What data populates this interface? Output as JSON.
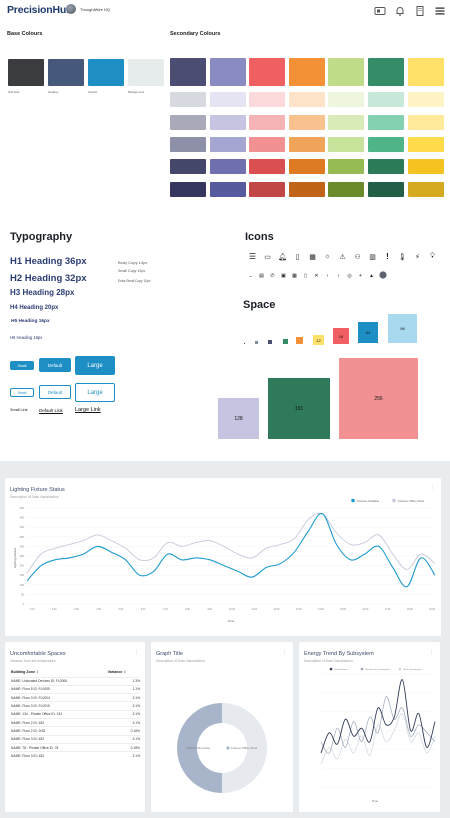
{
  "app": {
    "logo": "PrecisionHub",
    "org": "ThoughtWire HQ"
  },
  "colours": {
    "base_title": "Base Colours",
    "secondary_title": "Secondary Colours",
    "base": [
      {
        "name": "Sub Nav",
        "hex": "#3a3c40"
      },
      {
        "name": "Heather",
        "hex": "#46597a"
      },
      {
        "name": "Solaris",
        "hex": "#1e8fc5"
      },
      {
        "name": "Background",
        "hex": "#e6ebec"
      }
    ],
    "secondary_columns": [
      [
        "#4b4d72",
        "#d7d9e0",
        "#a9aab9",
        "#8e8fa8",
        "#45476a",
        "#35375e"
      ],
      [
        "#8b8bc4",
        "#e4e4f3",
        "#c5c5e2",
        "#a5a5d2",
        "#6f6fb0",
        "#565ba0"
      ],
      [
        "#f05f62",
        "#fcd9da",
        "#f6b3b5",
        "#f29194",
        "#d94f52",
        "#c14648"
      ],
      [
        "#f29136",
        "#fde3c8",
        "#f8c28e",
        "#f0a45a",
        "#dd7a22",
        "#c0641a"
      ],
      [
        "#bfdc88",
        "#eef6dd",
        "#d9ebb6",
        "#c7e29b",
        "#96bb52",
        "#6a8a2c"
      ],
      [
        "#358c68",
        "#c7e8d9",
        "#84d1b1",
        "#4fb487",
        "#2b7a58",
        "#225f46"
      ],
      [
        "#ffe16a",
        "#fff4c6",
        "#ffe99b",
        "#ffdb4a",
        "#f4c321",
        "#d6aa20"
      ]
    ]
  },
  "typography": {
    "title": "Typography",
    "h1": "H1 Heading 36px",
    "h2": "H2 Heading 32px",
    "h3": "H3 Heading 28px",
    "h4": "H4 Heading 20px",
    "h5": "H5 Heading 16px",
    "h6": "H6 Heading 16px",
    "body": "Body Copy 14px",
    "small": "Small Copy 12px",
    "extra_small": "Extra Small Copy 10px",
    "btn_small": "Small",
    "btn_default": "Default",
    "btn_large": "Large",
    "link_small": "Small Link",
    "link_default": "Default Link",
    "link_large": "Large Link"
  },
  "icons": {
    "title": "Icons"
  },
  "space": {
    "title": "Space",
    "labels": [
      "",
      "",
      "",
      "",
      "",
      "12",
      "16",
      "64",
      "96",
      "128",
      "191",
      "256"
    ]
  },
  "lighting": {
    "title": "Lighting Fixture Status",
    "subtitle": "Description of Data Visualization",
    "legend": [
      "Fixtures Available",
      "Fixtures Offline Shed"
    ],
    "ylabel": "Lighting Fixtures",
    "xlabel": "Time"
  },
  "spaces": {
    "title": "Uncomfortable Spaces",
    "subtitle": "Variance from set temperature",
    "col1": "Building Zone",
    "col2": "Variance",
    "rows": [
      [
        "NAME: Unlocated Devices ID: FL0006",
        "1.3%"
      ],
      [
        "NAME: Floor 5 ID: FL0005",
        "1.1%"
      ],
      [
        "NAME: Floor 3 ID: FL0004",
        "3.1%"
      ],
      [
        "NAME: Floor 3 ID: FL0015",
        "3.1%"
      ],
      [
        "NAME: 134 - Private Office ID: 134",
        "3.1%"
      ],
      [
        "NAME: Floor 2 ID: 452",
        "3.1%"
      ],
      [
        "NAME: Floor 2 ID: 2r52",
        "0.18%"
      ],
      [
        "NAME: Floor 3 ID: 452",
        "3.1%"
      ],
      [
        "NAME: 78 - Private Office ID: 78",
        "0.18%"
      ],
      [
        "NAME: Floor 3 ID: 452",
        "3.1%"
      ]
    ]
  },
  "graph": {
    "title": "Graph Title",
    "subtitle": "Description of Data Visualization",
    "legend": [
      "Fixtures Off at Area",
      "Fixtures Offline Shed"
    ]
  },
  "energy": {
    "title": "Energy Trend By Subsystem",
    "subtitle": "Description of Data Visualization",
    "legend": [
      "Default Name",
      "Mechanical Consumption",
      "Plant Consumption"
    ],
    "xlabel": "Time"
  },
  "chart_data": [
    {
      "type": "line",
      "series": [
        {
          "name": "Fixtures Available",
          "values": [
            120,
            200,
            230,
            240,
            260,
            300,
            270,
            230,
            150,
            170,
            260,
            230,
            240,
            230,
            200,
            170,
            140,
            190,
            210,
            270,
            380,
            470,
            310,
            230,
            260,
            300,
            190,
            90,
            240,
            150
          ]
        },
        {
          "name": "Fixtures Offline Shed",
          "values": [
            160,
            260,
            290,
            310,
            330,
            360,
            330,
            290,
            230,
            240,
            320,
            300,
            320,
            330,
            300,
            260,
            240,
            290,
            310,
            340,
            440,
            470,
            370,
            310,
            320,
            360,
            260,
            180,
            260,
            210
          ]
        }
      ],
      "ylim": [
        0,
        500
      ],
      "ylabel": "Lighting Fixtures",
      "xlabel": "Time"
    },
    {
      "type": "pie",
      "series": [
        {
          "name": "Fixtures Off at Area",
          "values": [
            50
          ]
        },
        {
          "name": "Fixtures Offline Shed",
          "values": [
            50
          ]
        }
      ]
    },
    {
      "type": "line",
      "series": [
        {
          "name": "Default Name",
          "values": [
            30,
            48,
            38,
            60,
            45,
            52,
            40,
            70,
            55,
            62,
            95,
            50,
            65,
            35,
            58
          ]
        },
        {
          "name": "Mechanical Consumption",
          "values": [
            40,
            30,
            52,
            35,
            58,
            40,
            62,
            48,
            80,
            60,
            70,
            45,
            55,
            48,
            40
          ]
        },
        {
          "name": "Plant Consumption",
          "values": [
            20,
            35,
            25,
            42,
            30,
            45,
            28,
            55,
            40,
            50,
            65,
            40,
            48,
            30,
            45
          ]
        }
      ],
      "xlabel": "Time"
    }
  ]
}
